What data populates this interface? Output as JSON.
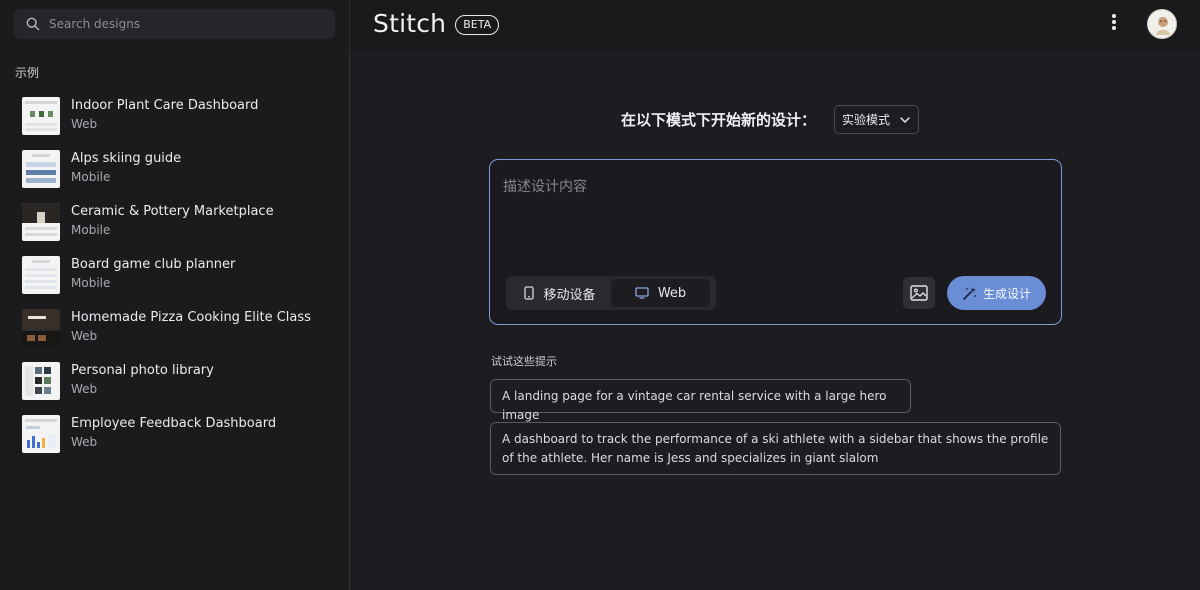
{
  "sidebar": {
    "search": {
      "placeholder": "Search designs"
    },
    "section_label": "示例",
    "examples": [
      {
        "title": "Indoor Plant Care Dashboard",
        "type": "Web"
      },
      {
        "title": "Alps skiing guide",
        "type": "Mobile"
      },
      {
        "title": "Ceramic & Pottery Marketplace",
        "type": "Mobile"
      },
      {
        "title": "Board game club planner",
        "type": "Mobile"
      },
      {
        "title": "Homemade Pizza Cooking Elite Class",
        "type": "Web"
      },
      {
        "title": "Personal photo library",
        "type": "Web"
      },
      {
        "title": "Employee Feedback Dashboard",
        "type": "Web"
      }
    ]
  },
  "header": {
    "brand": "Stitch",
    "badge": "BETA"
  },
  "main": {
    "start_text": "在以下模式下开始新的设计：",
    "mode_value": "实验模式",
    "prompt_placeholder": "描述设计内容",
    "device_mobile": "移动设备",
    "device_web": "Web",
    "generate_label": "生成设计",
    "try_label": "试试这些提示",
    "suggestions": [
      "A landing page for a vintage car rental service with a large hero image",
      "A dashboard to track the performance of a ski athlete with a sidebar that shows the profile of the athlete. Her name is Jess and specializes in giant slalom"
    ]
  },
  "colors": {
    "accent": "#6a8dd6",
    "prompt_border": "#7f9ad8",
    "background": "#1c1c21"
  }
}
